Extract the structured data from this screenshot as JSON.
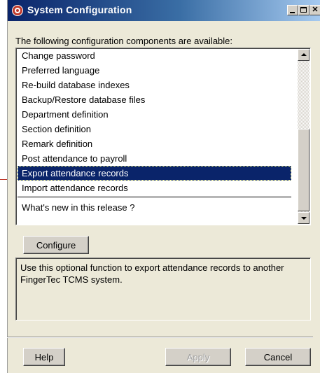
{
  "window": {
    "title": "System Configuration",
    "title_icon": "app-icon",
    "controls": [
      "minimize",
      "maximize",
      "close"
    ]
  },
  "intro_text": "The following configuration components are available:",
  "list": {
    "items": [
      {
        "label": "Change password"
      },
      {
        "label": "Preferred language"
      },
      {
        "label": "Re-build database indexes"
      },
      {
        "label": "Backup/Restore database files"
      },
      {
        "label": "Department definition"
      },
      {
        "label": "Section definition"
      },
      {
        "label": "Remark definition"
      },
      {
        "label": "Post attendance to payroll"
      },
      {
        "label": "Export attendance records"
      },
      {
        "label": "Import attendance records"
      },
      {
        "label": "What's new in this release ?"
      }
    ],
    "selected_index": 8
  },
  "buttons": {
    "configure": "Configure",
    "help": "Help",
    "apply": "Apply",
    "cancel": "Cancel"
  },
  "description": "Use this optional function to export attendance records to another FingerTec TCMS system.",
  "colors": {
    "selection": "#0a246a",
    "dialog_bg": "#ece9d8",
    "titlebar": "#0a246a",
    "pointer": "#c0392b"
  }
}
